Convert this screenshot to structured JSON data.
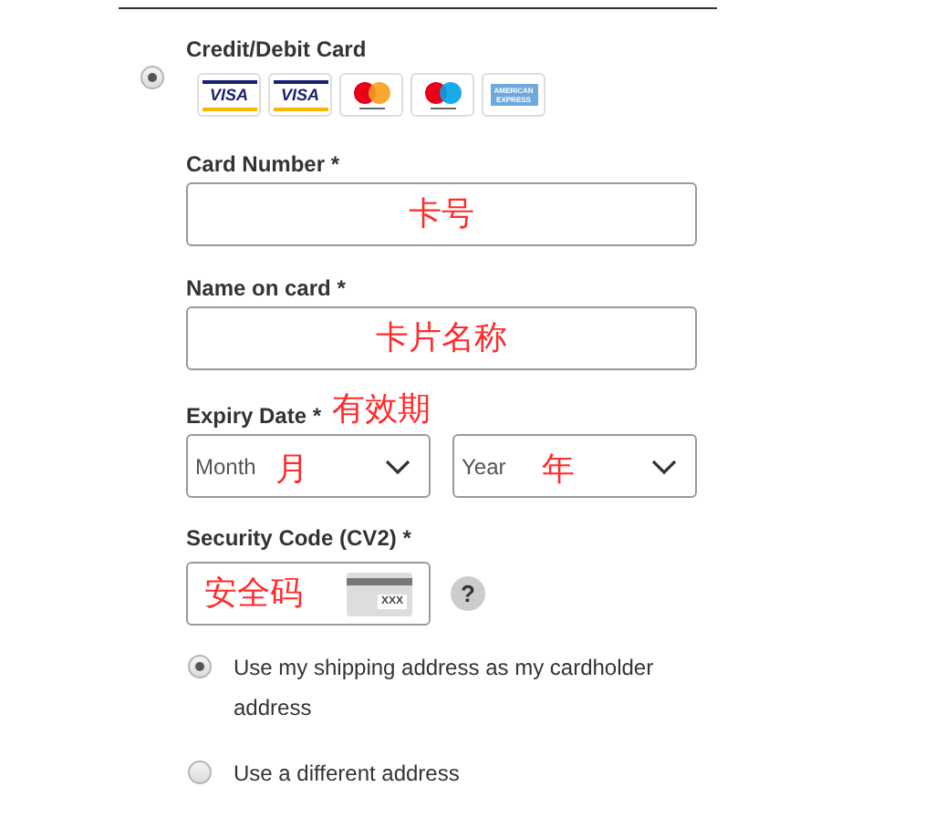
{
  "payment_option": {
    "label": "Credit/Debit Card",
    "selected": true
  },
  "card_logos": [
    {
      "kind": "visa",
      "label": "VISA"
    },
    {
      "kind": "visa_debit",
      "label": "VISA"
    },
    {
      "kind": "mastercard"
    },
    {
      "kind": "maestro"
    },
    {
      "kind": "amex",
      "label": "AMERICAN EXPRESS"
    }
  ],
  "card_number": {
    "label": "Card Number *",
    "annotation": "卡号"
  },
  "name_on_card": {
    "label": "Name on card *",
    "annotation": "卡片名称"
  },
  "expiry_date": {
    "label": "Expiry Date *",
    "annotation": "有效期",
    "month": {
      "value": "Month",
      "annotation": "月"
    },
    "year": {
      "value": "Year",
      "annotation": "年"
    }
  },
  "security_code": {
    "label": "Security Code (CV2) *",
    "annotation": "安全码",
    "card_hint": "XXX",
    "help": "?"
  },
  "address_options": [
    {
      "label": "Use my shipping address as my cardholder address",
      "selected": true
    },
    {
      "label": "Use a different address",
      "selected": false
    }
  ]
}
